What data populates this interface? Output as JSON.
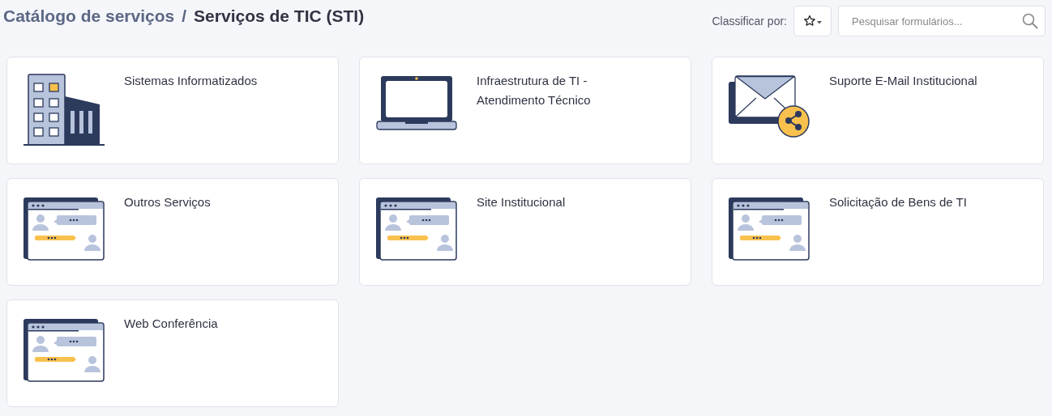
{
  "breadcrumb": {
    "parent": "Catálogo de serviços",
    "separator": "/",
    "current": "Serviços de TIC (STI)"
  },
  "sort": {
    "label": "Classificar por:"
  },
  "search": {
    "placeholder": "Pesquisar formulários..."
  },
  "cards": [
    {
      "kind": "building",
      "title": "Sistemas Informatizados"
    },
    {
      "kind": "laptop",
      "title": "Infraestrutura de TI - Atendimento Técnico"
    },
    {
      "kind": "mail",
      "title": "Suporte E-Mail Institucional"
    },
    {
      "kind": "chat",
      "title": "Outros Serviços"
    },
    {
      "kind": "chat",
      "title": "Site Institucional"
    },
    {
      "kind": "chat",
      "title": "Solicitação de Bens de TI"
    },
    {
      "kind": "chat",
      "title": "Web Conferência"
    }
  ]
}
